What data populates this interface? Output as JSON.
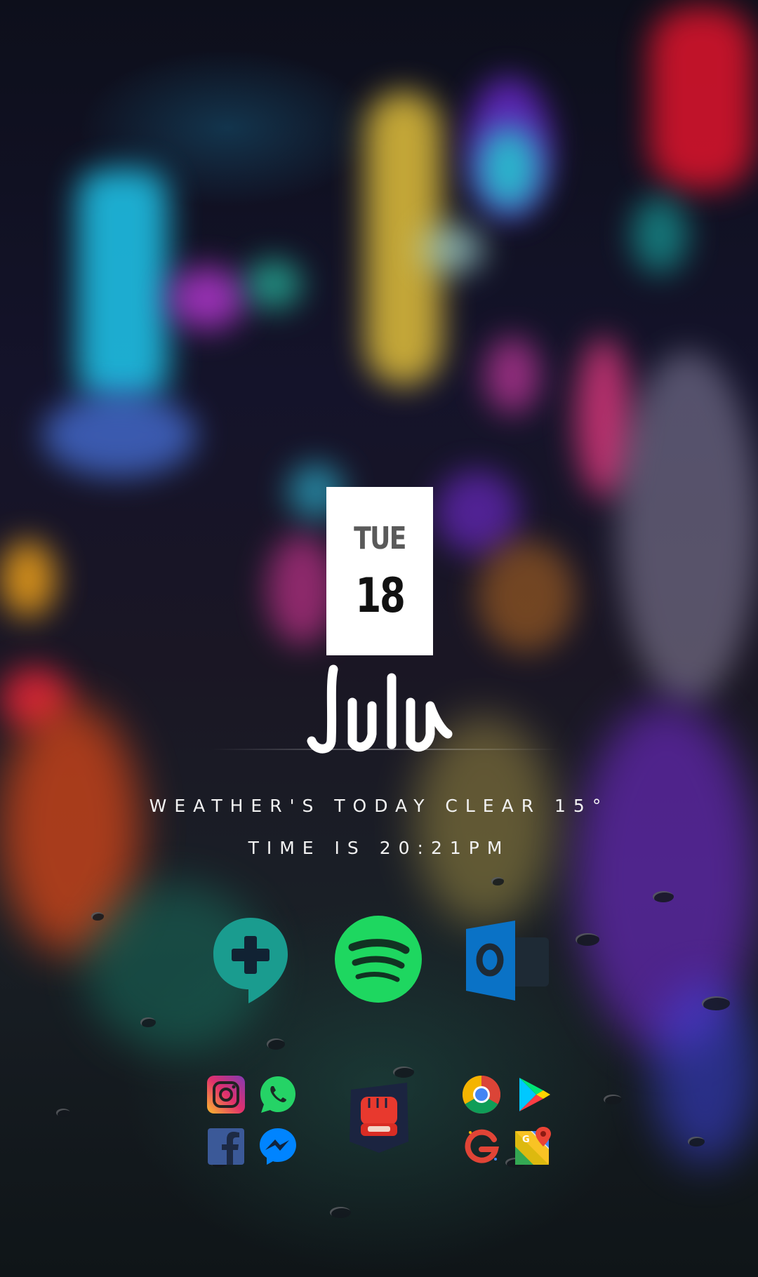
{
  "date_widget": {
    "day": "TUE",
    "date": "18"
  },
  "brand": {
    "name": "Julu"
  },
  "info": {
    "weather_line": "WEATHER'S TODAY CLEAR 15°",
    "time_line": "TIME IS 20:21PM"
  },
  "dock_large": [
    {
      "name": "Hangouts",
      "icon": "hangouts-icon"
    },
    {
      "name": "Spotify",
      "icon": "spotify-icon"
    },
    {
      "name": "Outlook",
      "icon": "outlook-icon"
    }
  ],
  "dock_small_left": [
    {
      "name": "Instagram",
      "icon": "instagram-icon"
    },
    {
      "name": "WhatsApp",
      "icon": "whatsapp-icon"
    },
    {
      "name": "Facebook",
      "icon": "facebook-icon"
    },
    {
      "name": "Messenger",
      "icon": "messenger-icon"
    }
  ],
  "dock_center": {
    "name": "Pokemon-style fist app",
    "icon": "fist-icon"
  },
  "dock_small_right": [
    {
      "name": "Chrome",
      "icon": "chrome-icon"
    },
    {
      "name": "Play Store",
      "icon": "play-store-icon"
    },
    {
      "name": "Google",
      "icon": "google-icon"
    },
    {
      "name": "Maps",
      "icon": "maps-icon"
    }
  ],
  "colors": {
    "spotify_green": "#1ed760",
    "hangouts_teal": "#1a9c8f",
    "outlook_blue": "#0a72c6",
    "facebook_blue": "#3b5998",
    "messenger_blue": "#0084ff",
    "whatsapp_green": "#25d366"
  }
}
